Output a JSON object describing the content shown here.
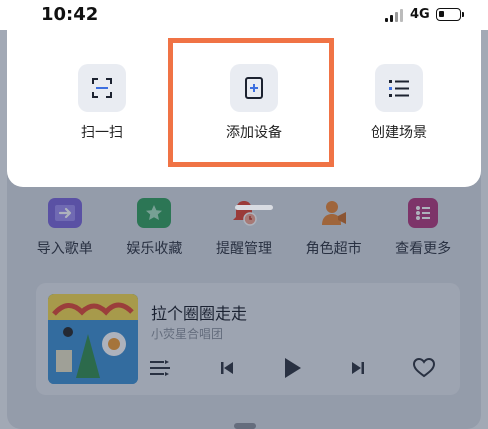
{
  "status_bar": {
    "time": "10:42",
    "network": "4G"
  },
  "menu": {
    "items": [
      {
        "label": "扫一扫",
        "icon": "scan-icon"
      },
      {
        "label": "添加设备",
        "icon": "add-device-icon"
      },
      {
        "label": "创建场景",
        "icon": "list-icon"
      }
    ],
    "highlight_color": "#f07345"
  },
  "shortcuts": [
    {
      "label": "导入歌单",
      "icon": "import-playlist-icon",
      "color": "#7a63d8"
    },
    {
      "label": "娱乐收藏",
      "icon": "star-folder-icon",
      "color": "#2f9e5a"
    },
    {
      "label": "提醒管理",
      "icon": "alarm-bell-icon",
      "color": "#e0402d"
    },
    {
      "label": "角色超市",
      "icon": "role-person-icon",
      "color": "#e8842f"
    },
    {
      "label": "查看更多",
      "icon": "more-grid-icon",
      "color": "#b2347a"
    }
  ],
  "player": {
    "song_title": "拉个圈圈走走",
    "artist": "小荧星合唱团"
  }
}
